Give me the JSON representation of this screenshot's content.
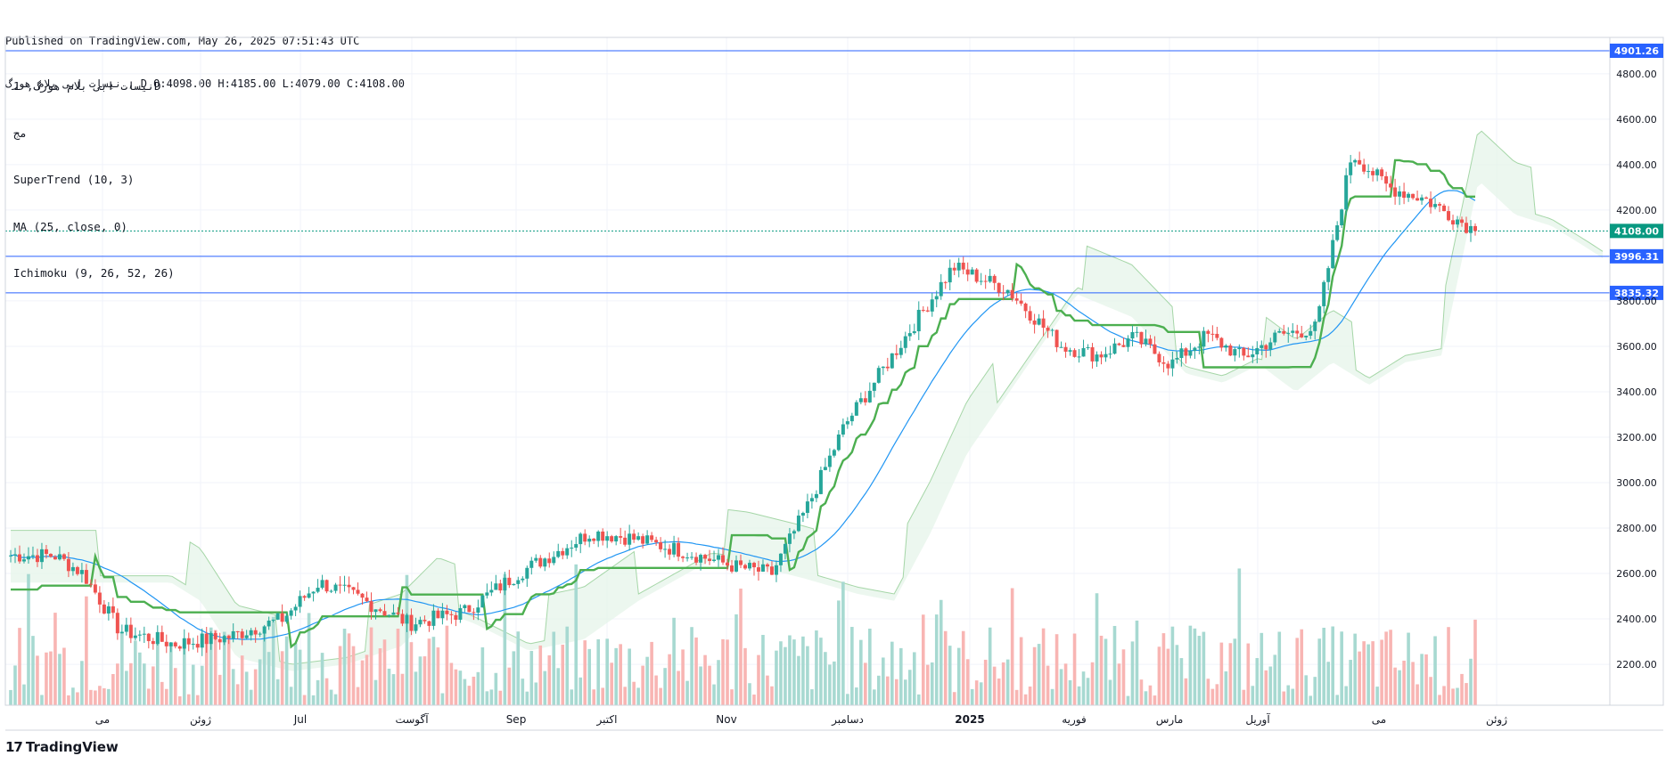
{
  "header": {
    "published": "Published on TradingView.com, May 26, 2025 07:51:43 UTC",
    "ohlc": "نیسات ابی بلام هورگ , D O:4098.00 H:4185.00 L:4079.00 C:4108.00"
  },
  "legend": {
    "symbol": "نیسات ابی بلام هورگ, 1D",
    "exchange": "مج",
    "ind1": "SuperTrend (10, 3)",
    "ind2": "MA (25, close, 0)",
    "ind3": "Ichimoku (9, 26, 52, 26)"
  },
  "footer": {
    "brand": "TradingView",
    "mark": "17"
  },
  "colors": {
    "up": "#26a69a",
    "down": "#ef5350",
    "grid": "#f0f3fa",
    "hline": "#2962ff",
    "last": "#089981",
    "st_up": "#4caf50",
    "st_down": "#b2514f",
    "ma": "#2196f3",
    "cloud_bull": "#e4f3e8",
    "cloud_bear": "#fde2e2"
  },
  "chart_data": {
    "type": "candlestick",
    "price_axis": [
      "4800.00",
      "4600.00",
      "4400.00",
      "4200.00",
      "3800.00",
      "3600.00",
      "3400.00",
      "3200.00",
      "3000.00",
      "2800.00",
      "2600.00",
      "2400.00",
      "2200.00"
    ],
    "time_axis": [
      "می",
      "ژوئن",
      "Jul",
      "آگوست",
      "Sep",
      "اکتبر",
      "Nov",
      "دسامبر",
      "2025",
      "فوریه",
      "مارس",
      "آوریل",
      "می",
      "ژوئن"
    ],
    "ylim": [
      2020,
      4960
    ],
    "horizontal_lines": [
      "4901.26",
      "3996.31",
      "3835.32"
    ],
    "last_price": "4108.00",
    "monthly_closes": [
      {
        "month": "می",
        "close": 2650
      },
      {
        "month": "ژوئن",
        "close": 2300
      },
      {
        "month": "Jul",
        "close": 2400
      },
      {
        "month": "آگوست",
        "close": 2380
      },
      {
        "month": "Sep",
        "close": 2780
      },
      {
        "month": "اکتبر",
        "close": 2700
      },
      {
        "month": "Nov",
        "close": 2650
      },
      {
        "month": "دسامبر",
        "close": 3600
      },
      {
        "month": "2025",
        "close": 3950
      },
      {
        "month": "فوریه",
        "close": 3700
      },
      {
        "month": "مارس",
        "close": 3550
      },
      {
        "month": "آوریل",
        "close": 3600
      },
      {
        "month": "می",
        "close": 4300
      },
      {
        "month": "ژوئن",
        "close": 4108
      }
    ]
  }
}
